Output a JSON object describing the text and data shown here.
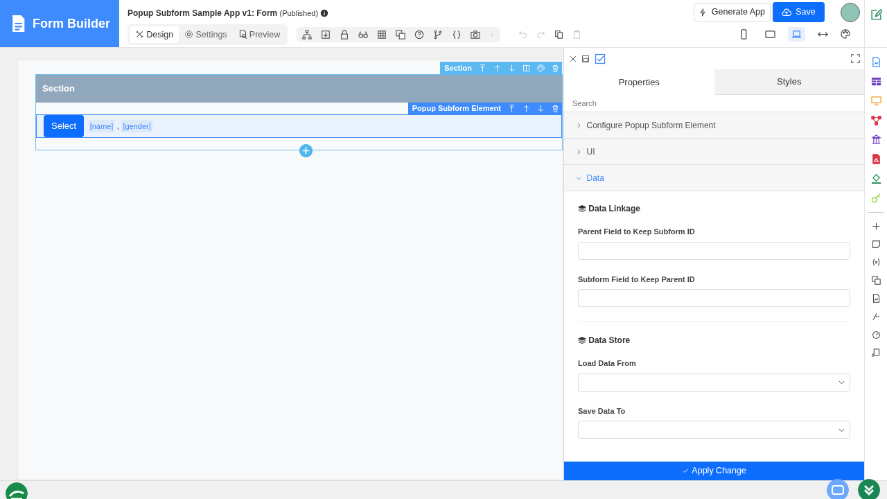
{
  "app": {
    "title": "Form Builder"
  },
  "header": {
    "title": "Popup Subform Sample App v1: Form",
    "status": "(Published)"
  },
  "mode_tabs": [
    {
      "label": "Design",
      "selected": true
    },
    {
      "label": "Settings",
      "selected": false
    },
    {
      "label": "Preview",
      "selected": false
    }
  ],
  "actions": {
    "generate": "Generate App",
    "save": "Save"
  },
  "device_buttons": [
    {
      "kind": "phone",
      "selected": false
    },
    {
      "kind": "tablet",
      "selected": false
    },
    {
      "kind": "laptop",
      "selected": true
    },
    {
      "kind": "full-width",
      "selected": false
    }
  ],
  "canvas": {
    "section_toolbar": "Section",
    "section_title": "Section",
    "element_toolbar": "Popup Subform Element",
    "select_button": "Select",
    "fields": [
      "[name]",
      "[gender]"
    ],
    "separator": ","
  },
  "panel": {
    "tabs": [
      {
        "label": "Properties",
        "selected": true
      },
      {
        "label": "Styles",
        "selected": false
      }
    ],
    "search_placeholder": "Search",
    "accordions": [
      {
        "label": "Configure Popup Subform Element",
        "expanded": false
      },
      {
        "label": "UI",
        "expanded": false
      },
      {
        "label": "Data",
        "expanded": true
      }
    ],
    "groups": [
      {
        "title": "Data Linkage",
        "fields": [
          {
            "label": "Parent Field to Keep Subform ID",
            "kind": "text"
          },
          {
            "label": "Subform Field to Keep Parent ID",
            "kind": "text"
          }
        ]
      },
      {
        "title": "Data Store",
        "fields": [
          {
            "label": "Load Data From",
            "kind": "select"
          },
          {
            "label": "Save Data To",
            "kind": "select"
          }
        ]
      }
    ],
    "apply": "Apply Change"
  }
}
